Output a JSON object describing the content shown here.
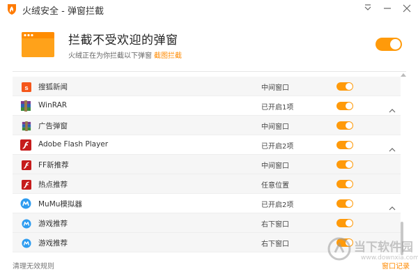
{
  "window": {
    "title": "火绒安全 - 弹窗拦截"
  },
  "header": {
    "title": "拦截不受欢迎的弹窗",
    "subtitle": "火绒正在为你拦截以下弹窗",
    "link": "截图拦截",
    "master_toggle_on": true
  },
  "rows": [
    {
      "name": "搜狐新闻",
      "mode": "中间窗口",
      "type": "child",
      "icon": "sohu-icon",
      "enabled": true,
      "chevron": false
    },
    {
      "name": "WinRAR",
      "mode": "已开启1项",
      "type": "parent",
      "icon": "winrar-icon",
      "enabled": true,
      "chevron": true
    },
    {
      "name": "广告弹窗",
      "mode": "中间窗口",
      "type": "child",
      "icon": "winrar-icon",
      "enabled": true,
      "chevron": false
    },
    {
      "name": "Adobe Flash Player",
      "mode": "已开启2项",
      "type": "parent",
      "icon": "flash-icon",
      "enabled": true,
      "chevron": true
    },
    {
      "name": "FF新推荐",
      "mode": "中间窗口",
      "type": "child",
      "icon": "flash-icon",
      "enabled": true,
      "chevron": false
    },
    {
      "name": "热点推荐",
      "mode": "任意位置",
      "type": "child",
      "icon": "flash-icon",
      "enabled": true,
      "chevron": false
    },
    {
      "name": "MuMu模拟器",
      "mode": "已开启2项",
      "type": "parent",
      "icon": "mumu-icon",
      "enabled": true,
      "chevron": true
    },
    {
      "name": "游戏推荐",
      "mode": "右下窗口",
      "type": "child",
      "icon": "mumu-icon",
      "enabled": true,
      "chevron": false
    },
    {
      "name": "游戏推荐",
      "mode": "右下窗口",
      "type": "child",
      "icon": "mumu-icon",
      "enabled": true,
      "chevron": false
    }
  ],
  "footer": {
    "left": "清理无效规则",
    "right": "窗口记录"
  },
  "watermark": {
    "text": "当下软件园",
    "url": "www.downxia.com"
  },
  "colors": {
    "accent": "#ff9a0a",
    "link": "#ff8a00",
    "child_row_bg": "#f6f6f6"
  }
}
